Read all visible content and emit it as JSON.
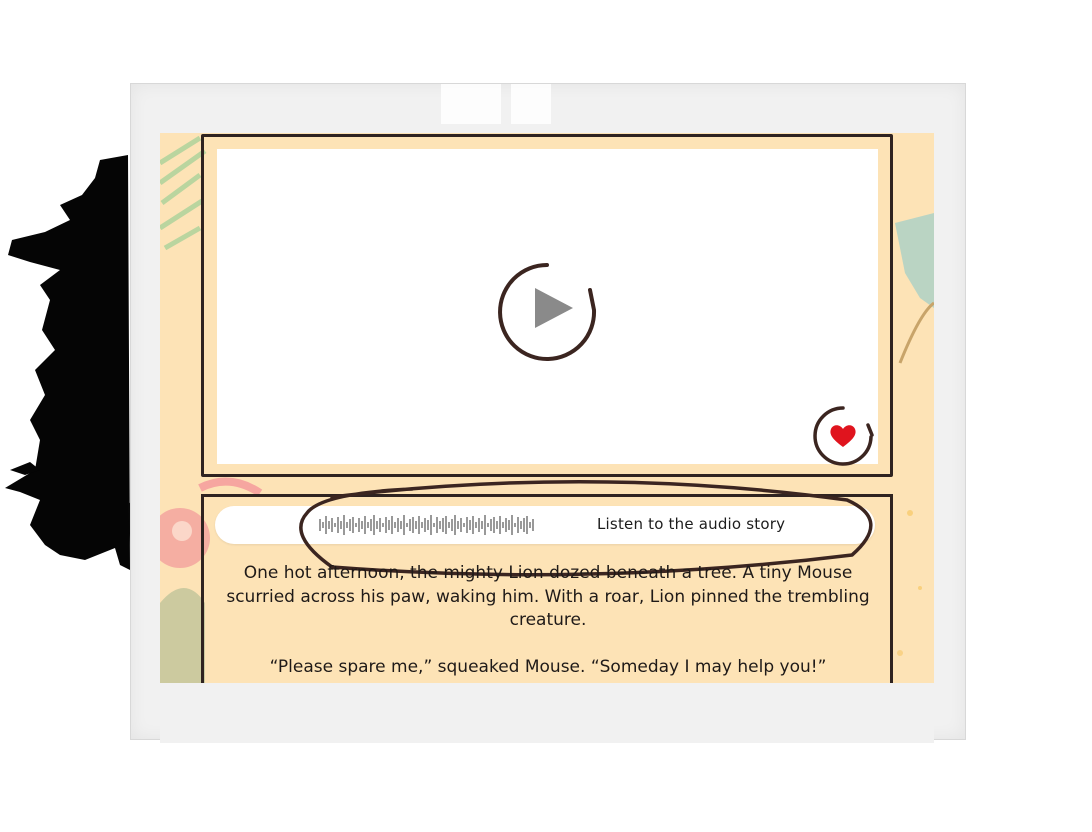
{
  "audio": {
    "label": "Listen to the audio story"
  },
  "story": {
    "paragraph1": "One hot afternoon, the mighty Lion dozed beneath a tree. A tiny Mouse scurried across his paw, waking him. With a roar, Lion pinned the trembling creature.",
    "paragraph2": "“Please spare me,” squeaked Mouse. “Someday I may help you!”"
  },
  "icons": {
    "play": "play-icon",
    "favorite": "heart-icon",
    "waveform": "waveform-icon"
  },
  "colors": {
    "board": "#fde3b6",
    "outline": "#3b2520",
    "heart": "#e0141e",
    "play_triangle": "#8a8a8a"
  }
}
